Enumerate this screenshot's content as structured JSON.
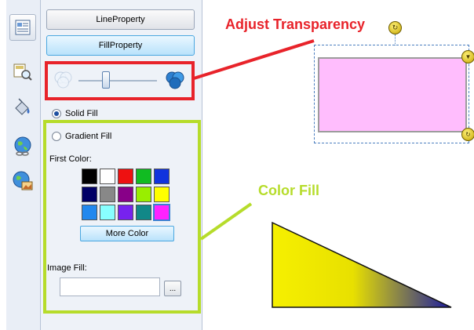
{
  "toolbar": {
    "icons": [
      "page-properties-icon",
      "search-object-icon",
      "fill-bucket-icon",
      "globe-link-icon",
      "globe-image-icon"
    ]
  },
  "panel": {
    "line_property_label": "LineProperty",
    "fill_property_label": "FillProperty",
    "transparency": {
      "level": 0.35,
      "min_icon": "transparent-circles-icon",
      "max_icon": "opaque-circles-icon"
    },
    "solid_fill_label": "Solid Fill",
    "solid_fill_selected": true,
    "gradient_fill_label": "Gradient Fill",
    "gradient_fill_selected": false,
    "first_color_label": "First Color:",
    "palette": [
      "#000000",
      "#ffffff",
      "#ee1111",
      "#11bb22",
      "#1133dd",
      "#000066",
      "#888888",
      "#880088",
      "#99ee00",
      "#ffff00",
      "#2288ee",
      "#88ffff",
      "#7722ee",
      "#118888",
      "#ff22ff"
    ],
    "selected_color_index": 14,
    "more_color_label": "More Color",
    "image_fill_label": "Image Fill:",
    "image_fill_value": "",
    "browse_label": "..."
  },
  "annotations": {
    "adjust_transparency": "Adjust Transparency",
    "color_fill": "Color Fill",
    "accent_red": "#e8232a",
    "accent_green": "#b6dc2b"
  },
  "canvas": {
    "rectangle_fill": "#ffbdfd",
    "triangle_gradient": [
      "#f6f000",
      "#1a1aa0"
    ]
  }
}
